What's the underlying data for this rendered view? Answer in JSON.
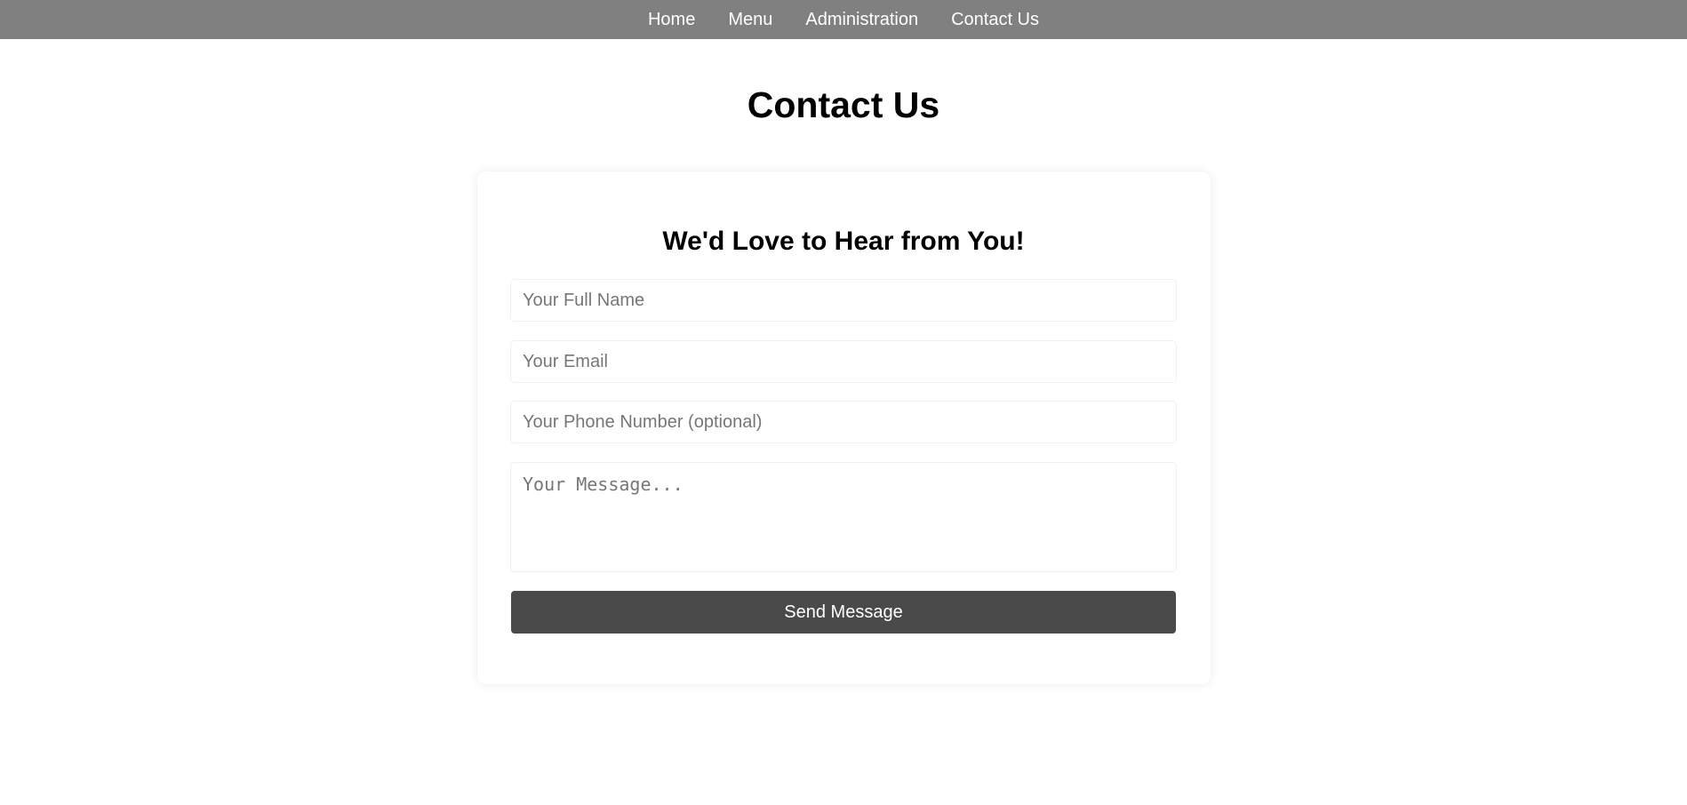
{
  "nav": {
    "items": [
      {
        "label": "Home"
      },
      {
        "label": "Menu"
      },
      {
        "label": "Administration"
      },
      {
        "label": "Contact Us"
      }
    ]
  },
  "page": {
    "title": "Contact Us"
  },
  "form": {
    "heading": "We'd Love to Hear from You!",
    "name_placeholder": "Your Full Name",
    "email_placeholder": "Your Email",
    "phone_placeholder": "Your Phone Number (optional)",
    "message_placeholder": "Your Message...",
    "submit_label": "Send Message"
  },
  "colors": {
    "navbar_bg": "#808080",
    "button_bg": "#4a4a4a",
    "page_bg": "#ffffff"
  }
}
